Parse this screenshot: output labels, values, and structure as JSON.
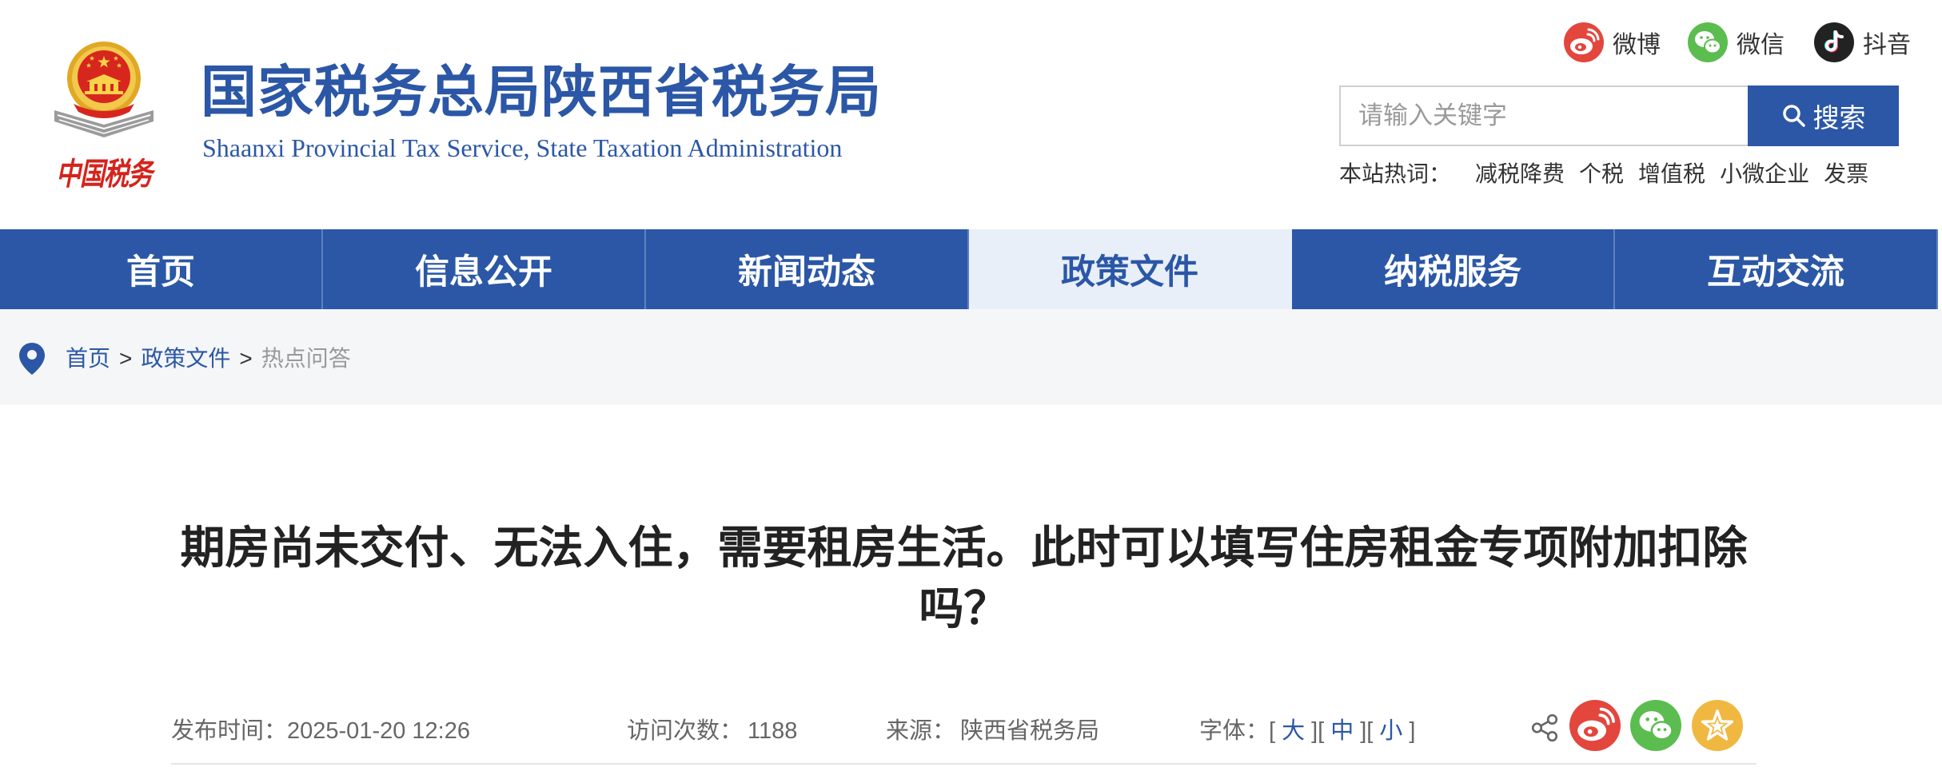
{
  "header": {
    "emblem_caption": "中国税务",
    "title_cn": "国家税务总局陕西省税务局",
    "title_en": "Shaanxi Provincial Tax Service, State Taxation Administration",
    "social": [
      {
        "label": "微博",
        "icon": "weibo-icon"
      },
      {
        "label": "微信",
        "icon": "wechat-icon"
      },
      {
        "label": "抖音",
        "icon": "douyin-icon"
      }
    ],
    "search": {
      "placeholder": "请输入关键字",
      "button_label": "搜索",
      "icon": "search-icon"
    },
    "hot_words_label": "本站热词：",
    "hot_words": [
      "减税降费",
      "个税",
      "增值税",
      "小微企业",
      "发票"
    ]
  },
  "nav": {
    "items": [
      "首页",
      "信息公开",
      "新闻动态",
      "政策文件",
      "纳税服务",
      "互动交流"
    ],
    "active": "政策文件"
  },
  "breadcrumb": {
    "icon": "location-pin-icon",
    "items": [
      "首页",
      "政策文件",
      "热点问答"
    ],
    "separator": ">"
  },
  "article": {
    "title": "期房尚未交付、无法入住，需要租房生活。此时可以填写住房租金专项附加扣除吗？",
    "meta": {
      "publish_label": "发布时间：",
      "publish_time": "2025-01-20 12:26",
      "visits_label": "访问次数：",
      "visits": "1188",
      "source_label": "来源：",
      "source": "陕西省税务局",
      "font_size_label": "字体：",
      "bracket_open": "[",
      "bracket_close": "]",
      "font_sizes": [
        "大",
        "中",
        "小"
      ]
    },
    "share_icons": [
      "share-icon",
      "weibo-share-icon",
      "wechat-share-icon",
      "favorite-star-icon"
    ]
  },
  "colors": {
    "primary": "#2b57a6",
    "nav_active_bg": "#e9eff8",
    "breadcrumb_bg": "#f5f6f8",
    "weibo": "#e3463d",
    "wechat": "#5bbd4f",
    "douyin": "#222222",
    "favorite": "#f0b840",
    "emblem_red": "#d7261e",
    "emblem_gold": "#e0a824"
  }
}
